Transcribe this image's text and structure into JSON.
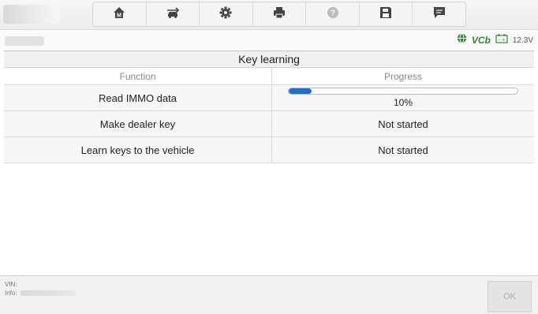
{
  "toolbar": {
    "buttons": [
      {
        "name": "home-button",
        "icon": "home-m-icon"
      },
      {
        "name": "vehicle-swap-button",
        "icon": "car-swap-icon"
      },
      {
        "name": "settings-button",
        "icon": "gear-icon"
      },
      {
        "name": "print-button",
        "icon": "printer-icon"
      },
      {
        "name": "help-button",
        "icon": "help-icon",
        "disabled": true
      },
      {
        "name": "save-button",
        "icon": "save-icon"
      },
      {
        "name": "datalog-button",
        "icon": "message-icon"
      }
    ]
  },
  "status": {
    "vci_label": "VCb",
    "voltage": "12.3V",
    "accent": "#2e8b2e"
  },
  "page": {
    "title": "Key learning"
  },
  "table": {
    "columns": [
      "Function",
      "Progress"
    ],
    "rows": [
      {
        "function": "Read IMMO data",
        "progress": 0.1,
        "progress_label": "10%"
      },
      {
        "function": "Make dealer key",
        "status": "Not started"
      },
      {
        "function": "Learn keys to the vehicle",
        "status": "Not started"
      }
    ]
  },
  "footer": {
    "vin_label": "VIN:",
    "info_label": "Info:",
    "ok_label": "OK"
  },
  "colors": {
    "progress_fill": "#1f6fd0"
  }
}
